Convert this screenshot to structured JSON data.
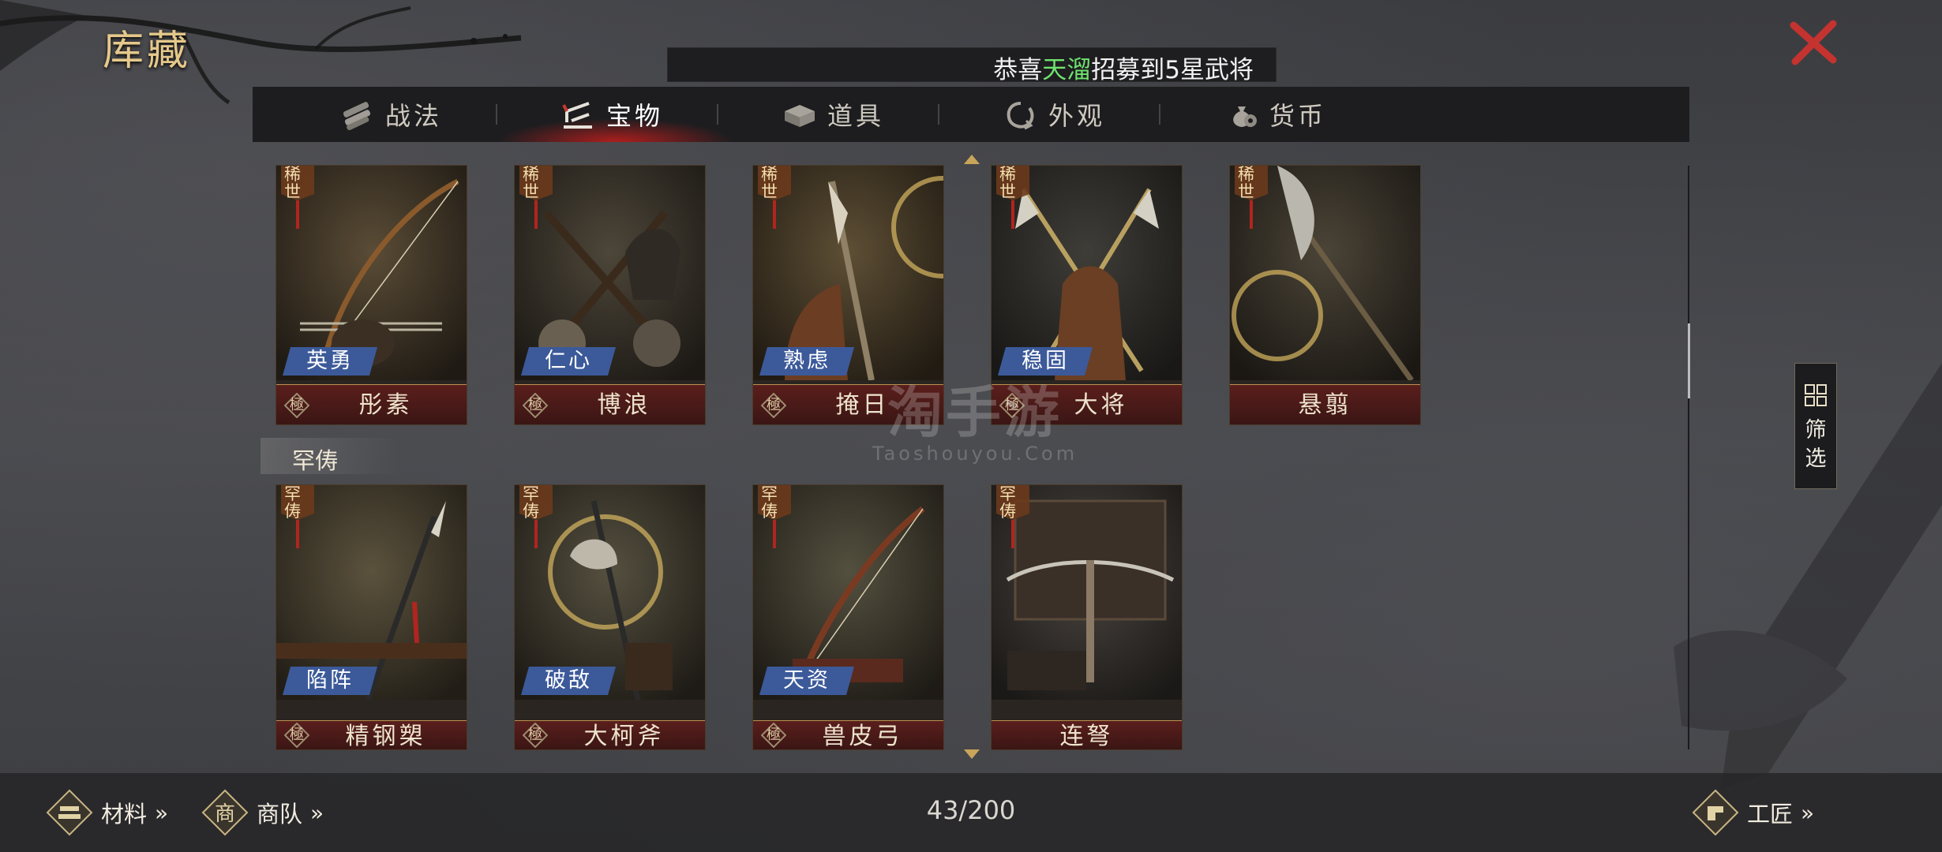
{
  "header": {
    "title": "库藏",
    "ticker": {
      "prefix": "恭喜",
      "name": "天溜",
      "suffix": "招募到5星武将"
    }
  },
  "tabs": [
    {
      "label": "战法",
      "icon": "scroll-bundle-icon",
      "active": false
    },
    {
      "label": "宝物",
      "icon": "treasure-icon",
      "active": true
    },
    {
      "label": "道具",
      "icon": "box-icon",
      "active": false
    },
    {
      "label": "外观",
      "icon": "appearance-icon",
      "active": false
    },
    {
      "label": "货币",
      "icon": "money-bag-icon",
      "active": false
    }
  ],
  "sections": {
    "row1_rarity": "稀世",
    "row2_label": "罕俦",
    "row2_rarity": "罕俦"
  },
  "grade_label": "極",
  "row1": [
    {
      "name": "彤素",
      "attr": "英勇",
      "graded": true,
      "art": "bow"
    },
    {
      "name": "博浪",
      "attr": "仁心",
      "graded": true,
      "art": "hammers"
    },
    {
      "name": "掩日",
      "attr": "熟虑",
      "graded": true,
      "art": "glaive"
    },
    {
      "name": "大将",
      "attr": "稳固",
      "graded": true,
      "art": "dual-halberd"
    },
    {
      "name": "悬翦",
      "attr": "",
      "graded": false,
      "art": "guandao"
    }
  ],
  "row2": [
    {
      "name": "精钢槊",
      "attr": "陷阵",
      "graded": true,
      "art": "spear"
    },
    {
      "name": "大柯斧",
      "attr": "破敌",
      "graded": true,
      "art": "axe-spear"
    },
    {
      "name": "兽皮弓",
      "attr": "天资",
      "graded": true,
      "art": "bow2"
    },
    {
      "name": "连弩",
      "attr": "",
      "graded": false,
      "art": "crossbow"
    }
  ],
  "footer": {
    "materials": "材料",
    "caravan": "商队",
    "caravan_icon_text": "商",
    "counter": "43/200",
    "artisan": "工匠"
  },
  "filter": {
    "l1": "筛",
    "l2": "选"
  },
  "watermark": {
    "cn": "淘手游",
    "en": "Taoshouyou.Com"
  },
  "colors": {
    "accent_gold": "#e5c88a",
    "close_red": "#c4332f",
    "ticker_highlight": "#6fe36f"
  }
}
